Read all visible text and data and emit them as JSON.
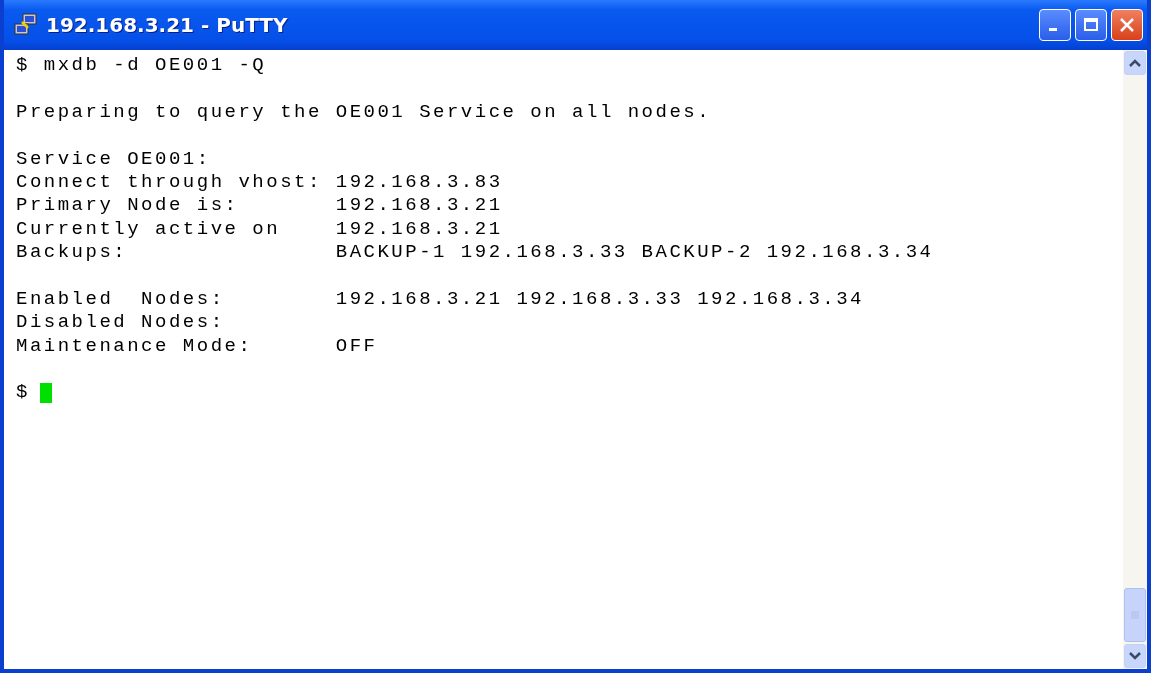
{
  "window": {
    "title": "192.168.3.21 - PuTTY"
  },
  "terminal": {
    "lines": [
      {
        "kind": "text",
        "text": "$ mxdb -d OE001 -Q"
      },
      {
        "kind": "blank"
      },
      {
        "kind": "text",
        "text": "Preparing to query the OE001 Service on all nodes."
      },
      {
        "kind": "blank"
      },
      {
        "kind": "text",
        "text": "Service OE001:"
      },
      {
        "kind": "text",
        "text": "Connect through vhost: 192.168.3.83"
      },
      {
        "kind": "text",
        "text": "Primary Node is:       192.168.3.21"
      },
      {
        "kind": "text",
        "text": "Currently active on    192.168.3.21"
      },
      {
        "kind": "text",
        "text": "Backups:               BACKUP-1 192.168.3.33 BACKUP-2 192.168.3.34"
      },
      {
        "kind": "blank"
      },
      {
        "kind": "text",
        "text": "Enabled  Nodes:        192.168.3.21 192.168.3.33 192.168.3.34"
      },
      {
        "kind": "text",
        "text": "Disabled Nodes:"
      },
      {
        "kind": "text",
        "text": "Maintenance Mode:      OFF"
      },
      {
        "kind": "blank"
      },
      {
        "kind": "prompt",
        "text": "$"
      }
    ]
  }
}
